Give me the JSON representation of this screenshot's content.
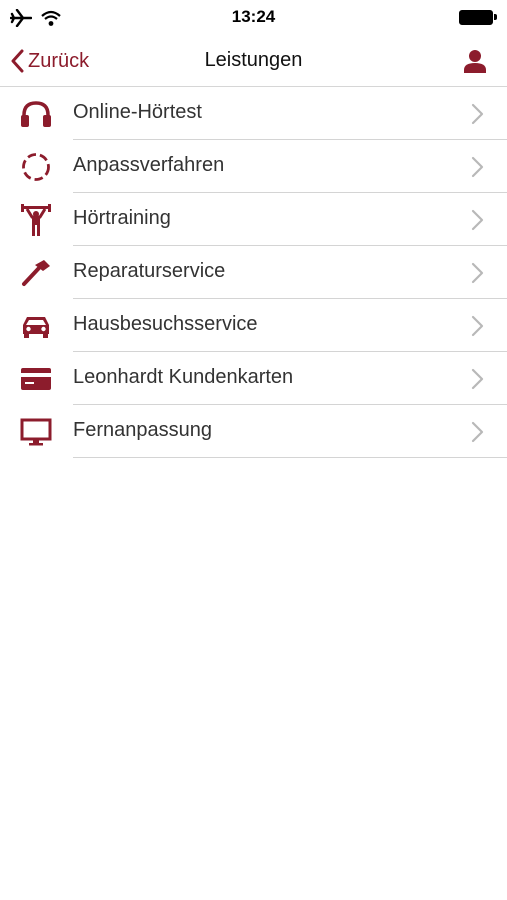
{
  "status": {
    "time": "13:24",
    "airplane_icon": "airplane-icon",
    "wifi_icon": "wifi-icon",
    "battery_icon": "battery-icon"
  },
  "nav": {
    "back_label": "Zurück",
    "title": "Leistungen",
    "profile_icon": "user-icon"
  },
  "colors": {
    "accent": "#8c1c2c",
    "divider": "#d4d4d4",
    "chevron": "#b8b8b8"
  },
  "services": [
    {
      "label": "Online-Hörtest",
      "icon": "headphones-icon"
    },
    {
      "label": "Anpassverfahren",
      "icon": "dashed-circle-icon"
    },
    {
      "label": "Hörtraining",
      "icon": "weightlifter-icon"
    },
    {
      "label": "Reparaturservice",
      "icon": "hammer-icon"
    },
    {
      "label": "Hausbesuchsservice",
      "icon": "car-icon"
    },
    {
      "label": "Leonhardt Kundenkarten",
      "icon": "credit-card-icon"
    },
    {
      "label": "Fernanpassung",
      "icon": "monitor-icon"
    }
  ]
}
